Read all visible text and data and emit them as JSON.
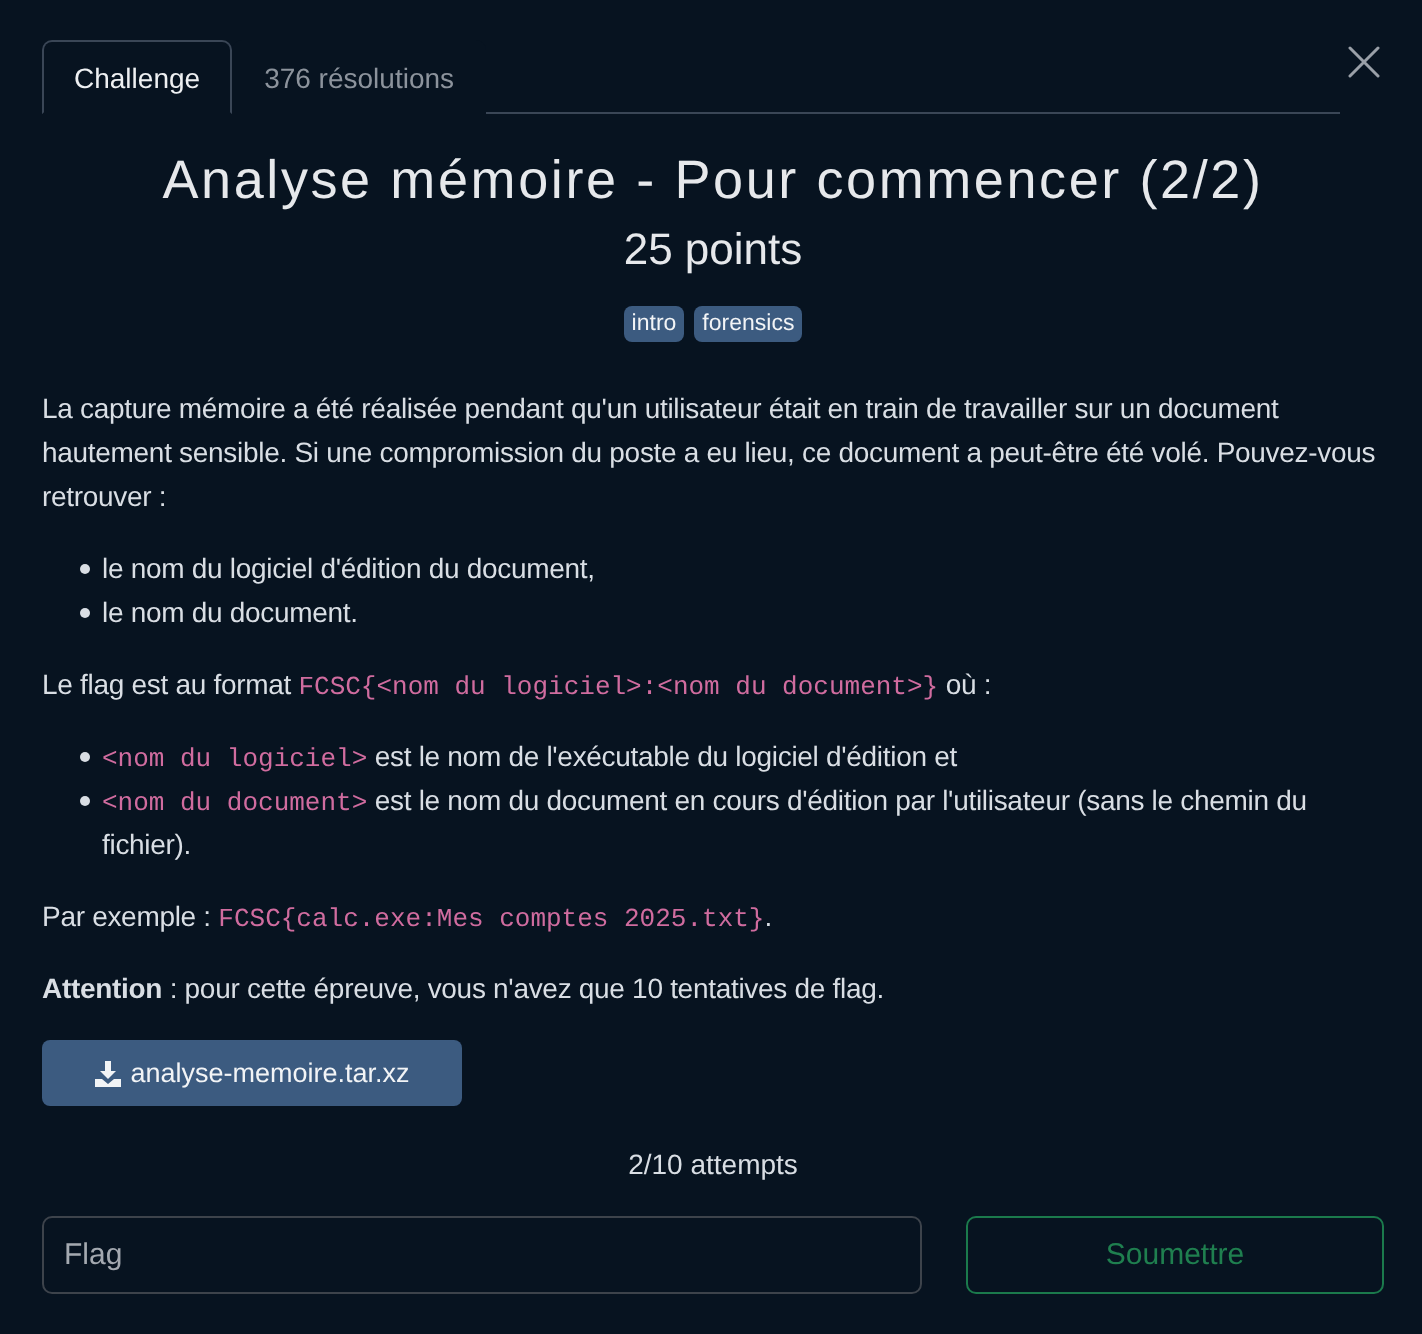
{
  "tabs": [
    {
      "label": "Challenge",
      "selected": true
    },
    {
      "label": "376 résolutions",
      "selected": false
    }
  ],
  "title": "Analyse mémoire - Pour commencer (2/2)",
  "points": "25 points",
  "tags": [
    "intro",
    "forensics"
  ],
  "description": [
    {
      "kind": "paragraph",
      "segments": [
        {
          "kind": "text",
          "text": "La capture mémoire a été réalisée pendant qu'un utilisateur était en train de travailler sur un document hautement sensible. Si une compromission du poste a eu lieu, ce document a peut-être été volé. Pouvez-vous retrouver :"
        }
      ]
    },
    {
      "kind": "list",
      "items": [
        [
          {
            "kind": "text",
            "text": "le nom du logiciel d'édition du document,"
          }
        ],
        [
          {
            "kind": "text",
            "text": "le nom du document."
          }
        ]
      ]
    },
    {
      "kind": "paragraph",
      "segments": [
        {
          "kind": "text",
          "text": "Le flag est au format "
        },
        {
          "kind": "code",
          "text": "FCSC{<nom du logiciel>:<nom du document>}"
        },
        {
          "kind": "text",
          "text": " où :"
        }
      ]
    },
    {
      "kind": "list",
      "items": [
        [
          {
            "kind": "code",
            "text": "<nom du logiciel>"
          },
          {
            "kind": "text",
            "text": " est le nom de l'exécutable du logiciel d'édition et"
          }
        ],
        [
          {
            "kind": "code",
            "text": "<nom du document>"
          },
          {
            "kind": "text",
            "text": " est le nom du document en cours d'édition par l'utilisateur (sans le chemin du fichier)."
          }
        ]
      ]
    },
    {
      "kind": "paragraph",
      "segments": [
        {
          "kind": "text",
          "text": "Par exemple : "
        },
        {
          "kind": "code",
          "text": "FCSC{calc.exe:Mes comptes 2025.txt}"
        },
        {
          "kind": "text",
          "text": "."
        }
      ]
    },
    {
      "kind": "paragraph",
      "segments": [
        {
          "kind": "bold",
          "text": "Attention"
        },
        {
          "kind": "text",
          "text": " : pour cette épreuve, vous n'avez que 10 tentatives de flag."
        }
      ]
    }
  ],
  "download": {
    "label": "analyse-memoire.tar.xz"
  },
  "attempts": "2/10 attempts",
  "flag_input": {
    "placeholder": "Flag"
  },
  "submit": {
    "label": "Soumettre"
  }
}
